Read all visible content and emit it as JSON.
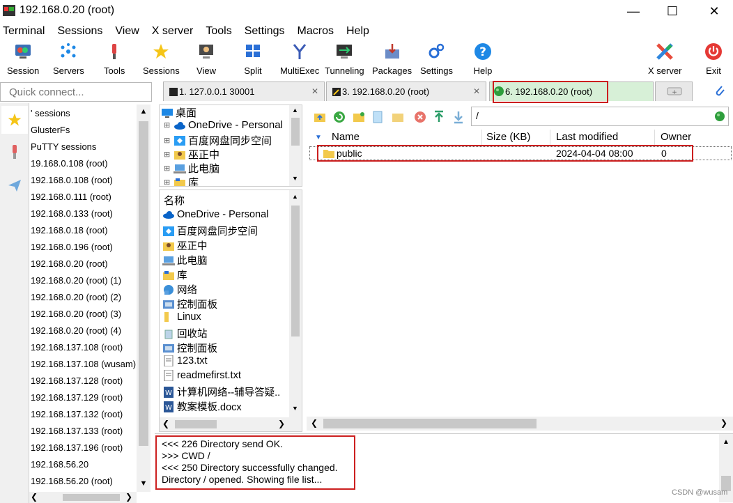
{
  "window": {
    "title": "192.168.0.20 (root)"
  },
  "menu": [
    "Terminal",
    "Sessions",
    "View",
    "X server",
    "Tools",
    "Settings",
    "Macros",
    "Help"
  ],
  "toolbar": {
    "items": [
      "Session",
      "Servers",
      "Tools",
      "Sessions",
      "View",
      "Split",
      "MultiExec",
      "Tunneling",
      "Packages",
      "Settings",
      "Help"
    ],
    "right_items": [
      "X server",
      "Exit"
    ]
  },
  "quick_connect": {
    "placeholder": "Quick connect..."
  },
  "tabs": [
    {
      "label": "1. 127.0.0.1 30001"
    },
    {
      "label": "3. 192.168.0.20 (root)"
    },
    {
      "label": "6. 192.168.0.20 (root)"
    }
  ],
  "sessions": [
    "' sessions",
    "GlusterFs",
    "PuTTY sessions",
    "19.168.0.108 (root)",
    "192.168.0.108 (root)",
    "192.168.0.111 (root)",
    "192.168.0.133 (root)",
    "192.168.0.18 (root)",
    "192.168.0.196 (root)",
    "192.168.0.20 (root)",
    "192.168.0.20 (root) (1)",
    "192.168.0.20 (root) (2)",
    "192.168.0.20 (root) (3)",
    "192.168.0.20 (root) (4)",
    "192.168.137.108 (root)",
    "192.168.137.108 (wusam)",
    "192.168.137.128 (root)",
    "192.168.137.129 (root)",
    "192.168.137.132 (root)",
    "192.168.137.133 (root)",
    "192.168.137.196 (root)",
    "192.168.56.20",
    "192.168.56.20 (root)"
  ],
  "local_tree": [
    "桌面",
    "OneDrive - Personal",
    "百度网盘同步空间",
    "巫正中",
    "此电脑",
    "库"
  ],
  "local_files": {
    "header": "名称",
    "items": [
      "OneDrive - Personal",
      "百度网盘同步空间",
      "巫正中",
      "此电脑",
      "库",
      "网络",
      "控制面板",
      "Linux",
      "回收站",
      "控制面板",
      "123.txt",
      "readmefirst.txt",
      "计算机网络--辅导答疑..",
      "教案模板.docx"
    ]
  },
  "remote": {
    "path": "/",
    "columns": [
      "Name",
      "Size (KB)",
      "Last modified",
      "Owner"
    ],
    "rows": [
      {
        "name": "public",
        "size": "",
        "modified": "2024-04-04 08:00",
        "owner": "0"
      }
    ]
  },
  "log": [
    "<<<  226 Directory send OK.",
    ">>>  CWD /",
    "<<<  250 Directory successfully changed.",
    "Directory / opened. Showing file list..."
  ],
  "watermark": "CSDN @wusam"
}
